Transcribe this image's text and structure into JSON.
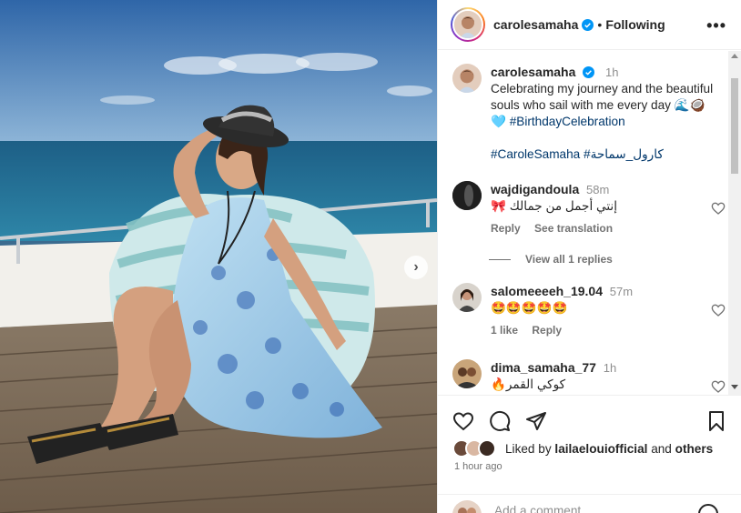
{
  "post": {
    "username": "carolesamaha",
    "follow_status": "Following",
    "more_icon": "more-horizontal-icon"
  },
  "caption": {
    "username": "carolesamaha",
    "time": "1h",
    "text_line": "Celebrating my journey and the beautiful souls who sail with me every day",
    "emojis": "🌊🥥🩵",
    "hashtag1": "#BirthdayCelebration",
    "hashtag2": "#CaroleSamaha",
    "hashtag3": "#كارول_سماحة"
  },
  "comments": [
    {
      "username": "wajdigandoula",
      "time": "58m",
      "text": "إنتي أجمل من جمالك 🎀",
      "reply_label": "Reply",
      "translate_label": "See translation"
    },
    {
      "username": "salomeeeeh_19.04",
      "time": "57m",
      "text": "🤩🤩🤩🤩🤩",
      "likes_label": "1 like",
      "reply_label": "Reply"
    },
    {
      "username": "dima_samaha_77",
      "time": "1h",
      "text": "كوكي القمر🔥"
    }
  ],
  "view_replies": "View all 1 replies",
  "liked_by": {
    "prefix": "Liked by",
    "user": "lailaelouiofficial",
    "and": "and",
    "others": "others"
  },
  "posted_ago": "1 hour ago",
  "add_comment_placeholder": "Add a comment...",
  "colors": {
    "hashtag": "#00376b",
    "verified": "#0095f6",
    "muted": "#737373"
  }
}
